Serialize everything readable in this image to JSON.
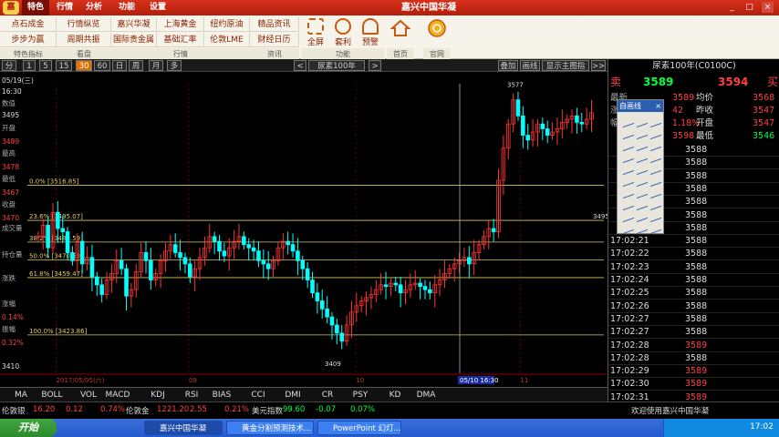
{
  "app": {
    "title": "嘉兴中国华凝",
    "logo": "嘉",
    "menu": [
      "特色",
      "行情",
      "分析",
      "功能",
      "设置"
    ],
    "window_buttons": [
      "_",
      "□",
      "×"
    ]
  },
  "toolbar": {
    "grid": [
      [
        "点石成金",
        "行情纵览",
        "嘉兴华凝",
        "上海黄金",
        "纽约原油",
        "精品资讯"
      ],
      [
        "步步为赢",
        "周期共振",
        "国际贵金属",
        "基础汇率",
        "伦敦LME",
        "财经日历"
      ]
    ],
    "groups": [
      "特色指标",
      "看盘",
      "行情",
      "资讯"
    ],
    "big_buttons": [
      "全屏",
      "套利",
      "预警"
    ],
    "func_group": "功能",
    "home_buttons": [
      "首页",
      "官网"
    ]
  },
  "periods": {
    "buttons": [
      "分",
      "1",
      "5",
      "15",
      "30",
      "60",
      "日",
      "周",
      "月",
      "多"
    ],
    "active": "30",
    "nav_prev": "<",
    "symbol": "尿素100年",
    "nav_next": ">",
    "right_buttons": [
      "叠加",
      "画线",
      "显示主图指标",
      ">>"
    ]
  },
  "chart_data": {
    "type": "candlestick",
    "ylim": [
      3400,
      3580
    ],
    "y_ticks": [
      3495,
      3489,
      3478,
      3467,
      3470,
      3410
    ],
    "fib_levels": [
      {
        "label": "0.0% [3516.85]",
        "value": 3516.85
      },
      {
        "label": "23.6% [3495.07]",
        "value": 3495.07
      },
      {
        "label": "38.2% [3481.59]",
        "value": 3481.59
      },
      {
        "label": "50.0% [3470.53]",
        "value": 3470.53
      },
      {
        "label": "61.8% [3459.47]",
        "value": 3459.47
      },
      {
        "label": "100.0% [3423.86]",
        "value": 3423.86
      }
    ],
    "high_label": "3577",
    "low_label": "3409",
    "cursor_value": "3495",
    "x_labels": [
      {
        "label": "2017/05/05(六)",
        "pos": 0.05
      },
      {
        "label": "09",
        "pos": 0.28
      },
      {
        "label": "10",
        "pos": 0.57
      },
      {
        "label": "05/10 16:30",
        "pos": 0.75
      },
      {
        "label": "11",
        "pos": 0.855
      }
    ],
    "closes": [
      3485,
      3492,
      3478,
      3500,
      3490,
      3488,
      3475,
      3470,
      3482,
      3468,
      3472,
      3460,
      3455,
      3449,
      3458,
      3462,
      3470,
      3465,
      3448,
      3452,
      3463,
      3475,
      3470,
      3458,
      3462,
      3470,
      3476,
      3480,
      3475,
      3472,
      3468,
      3460,
      3465,
      3472,
      3478,
      3485,
      3482,
      3476,
      3473,
      3478,
      3482,
      3485,
      3480,
      3478,
      3476,
      3470,
      3468,
      3465,
      3470,
      3478,
      3482,
      3480,
      3476,
      3470,
      3465,
      3458,
      3450,
      3445,
      3440,
      3435,
      3430,
      3425,
      3420,
      3430,
      3438,
      3442,
      3445,
      3447,
      3449,
      3452,
      3455,
      3454,
      3456,
      3455,
      3450,
      3452,
      3455,
      3456,
      3454,
      3452,
      3450,
      3455,
      3458,
      3462,
      3465,
      3468,
      3470,
      3472,
      3468,
      3475,
      3480,
      3485,
      3490,
      3488,
      3520,
      3540,
      3555,
      3570,
      3560,
      3548,
      3545,
      3550,
      3555,
      3552,
      3548,
      3550,
      3552,
      3556,
      3558,
      3560,
      3556,
      3555,
      3558,
      3562
    ]
  },
  "left_axis_labels": [
    "05/19(三)",
    "16:30",
    "数值",
    "3495",
    "开盘",
    "3489",
    "最高",
    "3478",
    "最低",
    "3467",
    "收盘",
    "3470",
    "成交量",
    "持仓量",
    "涨跌",
    "涨幅",
    "0.14%",
    "振幅",
    "0.32%",
    "3410"
  ],
  "right_panel": {
    "header": "尿素100年(C0100C)",
    "sell_label": "卖",
    "sell_price": "3589",
    "buy_price": "3594",
    "buy_label": "买",
    "stats": [
      {
        "l": "最新",
        "v": "3589",
        "l2": "均价",
        "v2": "3568"
      },
      {
        "l": "涨",
        "v": "42",
        "l2": "昨收",
        "v2": "3547"
      },
      {
        "l": "幅",
        "v": "1.18%",
        "l2": "开盘",
        "v2": "3547"
      },
      {
        "l": "",
        "v": "3598",
        "l2": "最低",
        "v2": "3546"
      }
    ],
    "ticks": [
      {
        "t": "",
        "p": "3588"
      },
      {
        "t": "",
        "p": "3588"
      },
      {
        "t": "",
        "p": "3588"
      },
      {
        "t": "",
        "p": "3588"
      },
      {
        "t": "",
        "p": "3588"
      },
      {
        "t": "",
        "p": "3588"
      },
      {
        "t": "",
        "p": "3588"
      },
      {
        "t": "17:02:21",
        "p": "3588"
      },
      {
        "t": "17:02:22",
        "p": "3588"
      },
      {
        "t": "17:02:23",
        "p": "3588"
      },
      {
        "t": "17:02:24",
        "p": "3588"
      },
      {
        "t": "17:02:25",
        "p": "3588"
      },
      {
        "t": "17:02:26",
        "p": "3588"
      },
      {
        "t": "17:02:27",
        "p": "3588"
      },
      {
        "t": "17:02:27",
        "p": "3588"
      },
      {
        "t": "17:02:28",
        "p": "3589"
      },
      {
        "t": "17:02:28",
        "p": "3588"
      },
      {
        "t": "17:02:29",
        "p": "3589"
      },
      {
        "t": "17:02:30",
        "p": "3589"
      },
      {
        "t": "17:02:31",
        "p": "3589"
      }
    ]
  },
  "draw_panel": {
    "title": "自画线",
    "close": "×"
  },
  "indicators": [
    "MA",
    "BOLL",
    "VOL",
    "MACD",
    "KDJ",
    "RSI",
    "BIAS",
    "CCI",
    "DMI",
    "CR",
    "PSY",
    "KD",
    "DMA"
  ],
  "status": {
    "items": [
      {
        "label": "伦敦银",
        "value": "16.20",
        "chg": "0.12",
        "pct": "0.74%"
      },
      {
        "label": "伦敦金",
        "value": "1221.20",
        "chg": "2.55",
        "pct": "0.21%"
      },
      {
        "label": "美元指数",
        "value": "99.60",
        "chg": "-0.07",
        "pct": "0.07%"
      }
    ],
    "welcome": "欢迎使用嘉兴中国华凝"
  },
  "taskbar": {
    "start": "开始",
    "tasks": [
      "嘉兴中国华凝",
      "黄金分割预测技术...",
      "PowerPoint 幻灯..."
    ],
    "clock": "17:02"
  },
  "colors": {
    "up": "#ff3333",
    "down": "#00ffff",
    "fib": "#d4c85a",
    "accent": "#c82a14"
  }
}
